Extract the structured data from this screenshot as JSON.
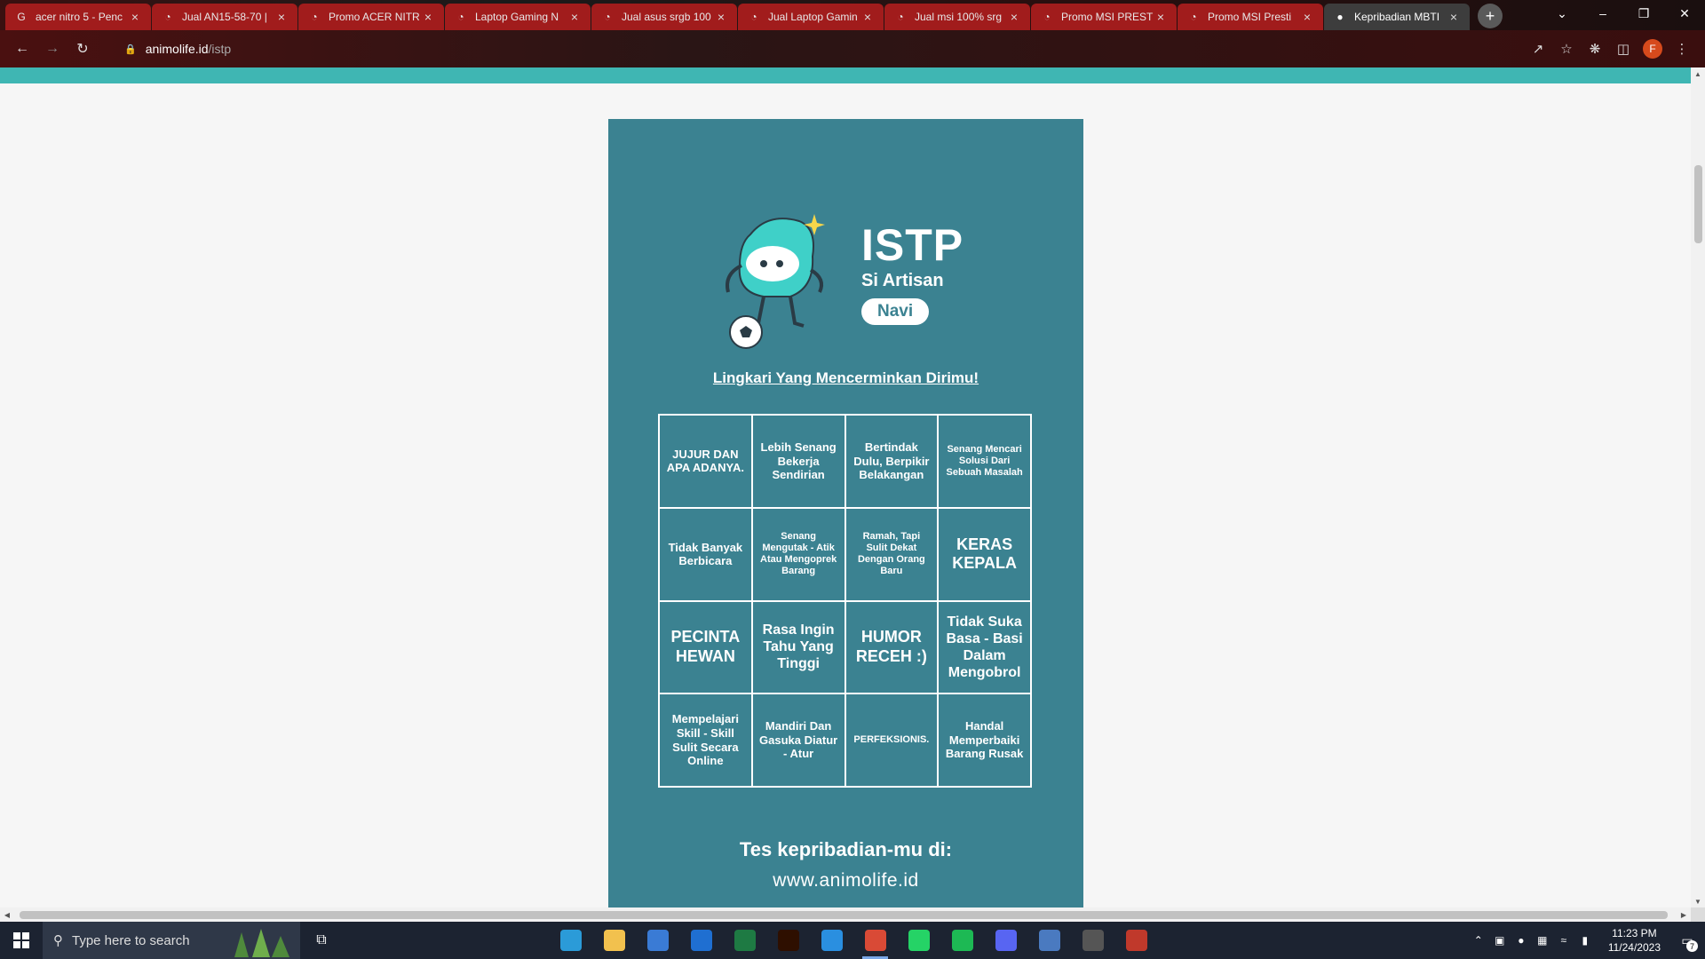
{
  "browser": {
    "tabs": [
      {
        "title": "acer nitro 5 - Penc",
        "favicon": "google-icon",
        "active": false
      },
      {
        "title": "Jual AN15-58-70 |",
        "favicon": "tokopedia-icon",
        "active": false
      },
      {
        "title": "Promo ACER NITR",
        "favicon": "tokopedia-icon",
        "active": false
      },
      {
        "title": "Laptop Gaming N",
        "favicon": "tokopedia-icon",
        "active": false
      },
      {
        "title": "Jual asus srgb 100",
        "favicon": "tokopedia-icon",
        "active": false
      },
      {
        "title": "Jual Laptop Gamin",
        "favicon": "tokopedia-icon",
        "active": false
      },
      {
        "title": "Jual msi 100% srg",
        "favicon": "tokopedia-icon",
        "active": false
      },
      {
        "title": "Promo MSI PREST",
        "favicon": "tokopedia-icon",
        "active": false
      },
      {
        "title": "Promo MSI Presti",
        "favicon": "tokopedia-icon",
        "active": false
      },
      {
        "title": "Kepribadian MBTI",
        "favicon": "animolife-icon",
        "active": true
      }
    ],
    "url_domain": "animolife.id",
    "url_path": "/istp",
    "profile_initial": "F",
    "accent": "#3b8291"
  },
  "page": {
    "type_code": "ISTP",
    "nickname": "Si Artisan",
    "character": "Navi",
    "instruction": "Lingkari Yang Mencerminkan Dirimu!",
    "bingo": [
      {
        "text": "JUJUR DAN APA ADANYA.",
        "size": "md"
      },
      {
        "text": "Lebih Senang Bekerja Sendirian",
        "size": "md"
      },
      {
        "text": "Bertindak Dulu, Berpikir Belakangan",
        "size": "md"
      },
      {
        "text": "Senang Mencari Solusi Dari Sebuah Masalah",
        "size": "sm"
      },
      {
        "text": "Tidak Banyak Berbicara",
        "size": "md"
      },
      {
        "text": "Senang Mengutak - Atik Atau Mengoprek Barang",
        "size": "sm"
      },
      {
        "text": "Ramah, Tapi Sulit Dekat Dengan Orang Baru",
        "size": "sm"
      },
      {
        "text": "KERAS KEPALA",
        "size": "xl"
      },
      {
        "text": "PECINTA HEWAN",
        "size": "xl"
      },
      {
        "text": "Rasa Ingin Tahu Yang Tinggi",
        "size": "lg"
      },
      {
        "text": "HUMOR RECEH :)",
        "size": "xl"
      },
      {
        "text": "Tidak Suka Basa - Basi Dalam Mengobrol",
        "size": "lg"
      },
      {
        "text": "Mempelajari Skill - Skill Sulit Secara Online",
        "size": "md"
      },
      {
        "text": "Mandiri Dan Gasuka Diatur - Atur",
        "size": "md"
      },
      {
        "text": "PERFEKSIONIS.",
        "size": "sm"
      },
      {
        "text": "Handal Memperbaiki Barang Rusak",
        "size": "md"
      }
    ],
    "cta_title": "Tes kepribadian-mu di:",
    "cta_url": "www.animolife.id"
  },
  "taskbar": {
    "search_placeholder": "Type here to search",
    "time": "11:23 PM",
    "date": "11/24/2023",
    "notification_count": "7",
    "apps": [
      {
        "name": "edge-icon",
        "color": "#2b9bd8",
        "active": false
      },
      {
        "name": "file-explorer-icon",
        "color": "#f2c14e",
        "active": false
      },
      {
        "name": "microsoft-store-icon",
        "color": "#3a7bd5",
        "active": false
      },
      {
        "name": "outlook-icon",
        "color": "#1f6fd1",
        "active": false
      },
      {
        "name": "excel-icon",
        "color": "#1e7a43",
        "active": false
      },
      {
        "name": "illustrator-icon",
        "color": "#2e0f00",
        "active": false
      },
      {
        "name": "vscode-icon",
        "color": "#2a8fe0",
        "active": false
      },
      {
        "name": "chrome-icon",
        "color": "#d94a36",
        "active": true
      },
      {
        "name": "whatsapp-icon",
        "color": "#25d366",
        "active": false
      },
      {
        "name": "spotify-icon",
        "color": "#1db954",
        "active": false
      },
      {
        "name": "discord-icon",
        "color": "#5865f2",
        "active": false
      },
      {
        "name": "ide-icon",
        "color": "#4a7ac0",
        "active": false
      },
      {
        "name": "settings-icon",
        "color": "#555555",
        "active": false
      },
      {
        "name": "app-icon",
        "color": "#c0392b",
        "active": false
      }
    ]
  }
}
